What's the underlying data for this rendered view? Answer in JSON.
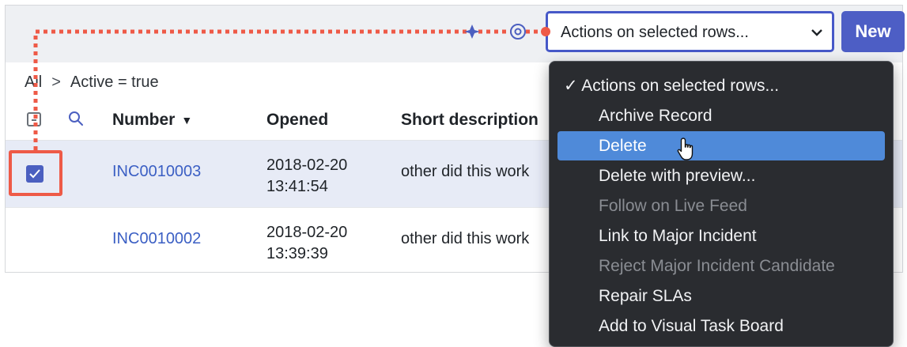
{
  "breadcrumb": {
    "all": "All",
    "separator": ">",
    "filter": "Active = true"
  },
  "toolbar": {
    "actions_select_value": "Actions on selected rows...",
    "new_label": "New"
  },
  "table": {
    "columns": [
      {
        "label": "Number",
        "sorted": "descending"
      },
      {
        "label": "Opened"
      },
      {
        "label": "Short description"
      }
    ],
    "rows": [
      {
        "number": "INC0010003",
        "opened_date": "2018-02-20",
        "opened_time": "13:41:54",
        "description": "other did this work",
        "checked": true
      },
      {
        "number": "INC0010002",
        "opened_date": "2018-02-20",
        "opened_time": "13:39:39",
        "description": "other did this work",
        "checked": false
      }
    ]
  },
  "menu": {
    "items": [
      {
        "label": "✓ Actions on selected rows...",
        "state": "checked"
      },
      {
        "label": "Archive Record",
        "state": "enabled"
      },
      {
        "label": "Delete",
        "state": "highlighted"
      },
      {
        "label": "Delete with preview...",
        "state": "enabled"
      },
      {
        "label": "Follow on Live Feed",
        "state": "disabled"
      },
      {
        "label": "Link to Major Incident",
        "state": "enabled"
      },
      {
        "label": "Reject Major Incident Candidate",
        "state": "disabled"
      },
      {
        "label": "Repair SLAs",
        "state": "enabled"
      },
      {
        "label": "Add to Visual Task Board",
        "state": "enabled"
      }
    ]
  },
  "colors": {
    "accent": "#4d5ec5",
    "annotation": "#ee5a47",
    "menu_bg": "#2a2c30",
    "menu_highlight": "#4f8ad9",
    "link": "#3b5fc4"
  },
  "icons": [
    "search-icon",
    "chevron-down-icon",
    "checkmark-icon",
    "hand-pointer-cursor-icon",
    "gear-icon",
    "sparkle-icon"
  ]
}
